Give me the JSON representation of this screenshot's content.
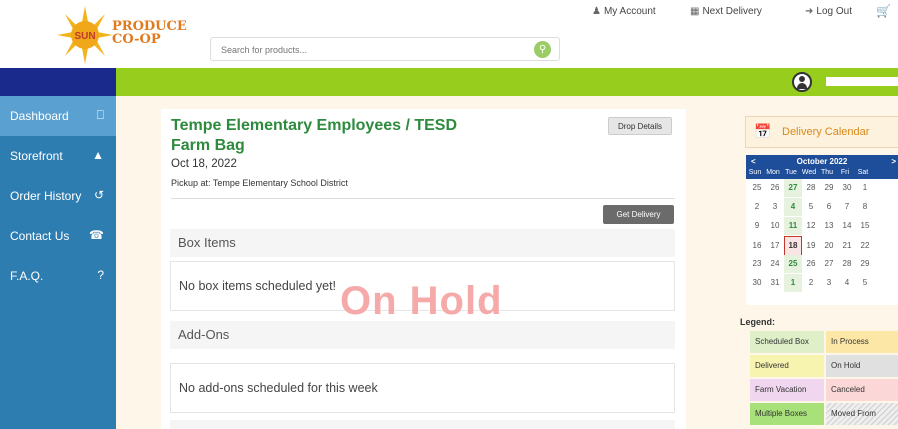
{
  "header": {
    "logo_text_line1": "PRODUCE",
    "logo_text_line2": "CO-OP",
    "logo_sun_text": "SUN",
    "search_placeholder": "Search for products...",
    "nav": {
      "my_account": "My Account",
      "next_delivery": "Next Delivery",
      "log_out": "Log Out"
    }
  },
  "sidebar": {
    "items": [
      {
        "label": "Dashboard",
        "icon": "monitor-icon"
      },
      {
        "label": "Storefront",
        "icon": "shopping-bag-icon"
      },
      {
        "label": "Order History",
        "icon": "history-icon"
      },
      {
        "label": "Contact Us",
        "icon": "support-icon"
      },
      {
        "label": "F.A.Q.",
        "icon": "question-icon"
      }
    ]
  },
  "main": {
    "title": "Tempe Elementary Employees / TESD Farm Bag",
    "date": "Oct 18, 2022",
    "pickup": "Pickup at: Tempe Elementary School District",
    "drop_details": "Drop Details",
    "get_delivery": "Get Delivery",
    "box_items_heading": "Box Items",
    "box_items_empty": "No box items scheduled yet!",
    "addons_heading": "Add-Ons",
    "addons_empty": "No add-ons scheduled for this week",
    "status_watermark": "On Hold"
  },
  "calendar": {
    "heading": "Delivery Calendar",
    "month": "October 2022",
    "prev": "<",
    "next": ">",
    "dow": [
      "Sun",
      "Mon",
      "Tue",
      "Wed",
      "Thu",
      "Fri",
      "Sat"
    ],
    "weeks": [
      [
        "25",
        "26",
        "27",
        "28",
        "29",
        "30",
        "1"
      ],
      [
        "2",
        "3",
        "4",
        "5",
        "6",
        "7",
        "8"
      ],
      [
        "9",
        "10",
        "11",
        "12",
        "13",
        "14",
        "15"
      ],
      [
        "16",
        "17",
        "18",
        "19",
        "20",
        "21",
        "22"
      ],
      [
        "23",
        "24",
        "25",
        "26",
        "27",
        "28",
        "29"
      ],
      [
        "30",
        "31",
        "1",
        "2",
        "3",
        "4",
        "5"
      ]
    ],
    "highlighted": [
      "27",
      "4",
      "11",
      "25",
      "1"
    ],
    "today": "18"
  },
  "legend": {
    "title": "Legend:",
    "items": [
      {
        "label": "Scheduled Box",
        "color": "#dff0c8"
      },
      {
        "label": "In Process",
        "color": "#fde7a6"
      },
      {
        "label": "Delivered",
        "color": "#f7f4b0"
      },
      {
        "label": "On Hold",
        "color": "#e0e0e0"
      },
      {
        "label": "Farm Vacation",
        "color": "#f0d6ef"
      },
      {
        "label": "Canceled",
        "color": "#fbd7d7"
      },
      {
        "label": "Multiple Boxes",
        "color": "#a8e07a"
      },
      {
        "label": "Moved From",
        "color": "#eeeeee"
      }
    ]
  },
  "colors": {
    "green_bar": "#97cd1d",
    "blue_bar": "#1a2a8c",
    "sidebar": "#2e7db1",
    "title_green": "#2e8b3e",
    "hold_pink": "#f6a9a9"
  }
}
